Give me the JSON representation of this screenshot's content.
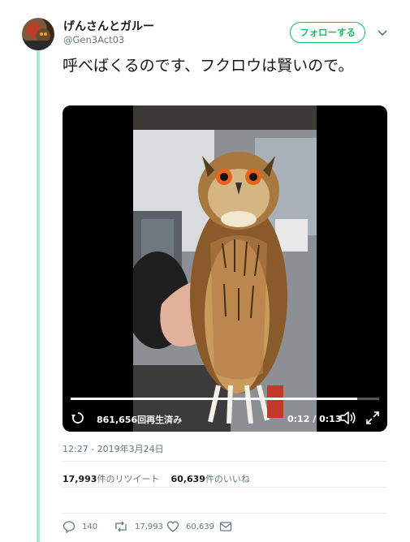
{
  "author": {
    "display_name": "げんさんとガルー",
    "handle": "@Gen3Act03"
  },
  "follow_button": {
    "label": "フォローする"
  },
  "menu": {
    "icon": "chevron-down-icon"
  },
  "tweet": {
    "text": "呼べばくるのです、フクロウは賢いので。"
  },
  "video": {
    "views_label": "861,656回再生済み",
    "current_time": "0:12",
    "duration": "0:13",
    "progress": 0.93,
    "icons": [
      "replay-icon",
      "volume-icon",
      "fullscreen-icon"
    ]
  },
  "timestamp": "12:27 - 2019年3月24日",
  "stats": {
    "retweets_count": "17,993",
    "retweets_label": "件のリツイート",
    "likes_count": "60,639",
    "likes_label": "件のいいね"
  },
  "actions": {
    "reply_count": "140",
    "retweet_count": "17,993",
    "like_count": "60,639"
  },
  "colors": {
    "accent": "#17bf63",
    "thread_line": "#aee4d3",
    "secondary_text": "#657786"
  }
}
